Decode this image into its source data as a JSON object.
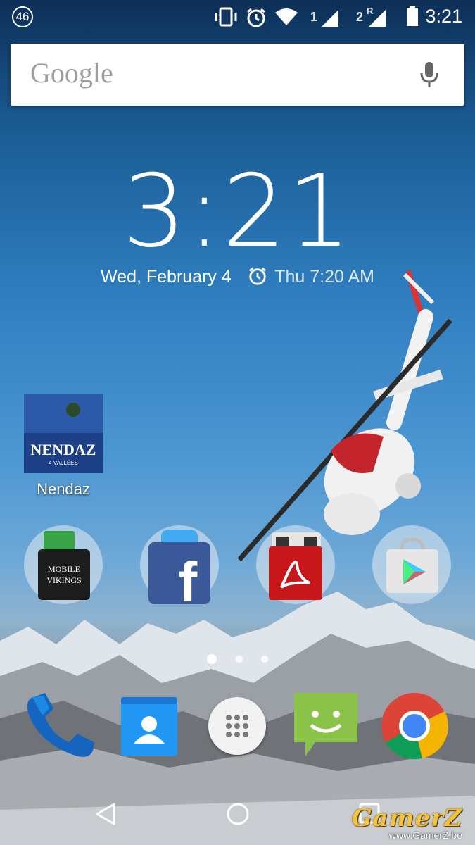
{
  "status_bar": {
    "notification_count": "46",
    "sim1_label": "1",
    "sim2_label": "2",
    "sim2_roaming": "R",
    "time": "3:21",
    "icons": [
      "vibrate-icon",
      "alarm-icon",
      "wifi-icon",
      "signal-icon",
      "signal-roaming-icon",
      "battery-icon"
    ]
  },
  "search": {
    "logo_text": "Google",
    "icons": [
      "mic-icon"
    ]
  },
  "clock_widget": {
    "time": "3:21",
    "date": "Wed, February 4",
    "next_alarm": "Thu 7:20 AM"
  },
  "shortcuts": [
    {
      "label": "Nendaz",
      "logo_text": "NENDAZ",
      "logo_subtext": "4 VALLÉES"
    }
  ],
  "folders": [
    {
      "icon": "mobile-vikings-icon",
      "text_line1": "MOBILE",
      "text_line2": "VIKINGS"
    },
    {
      "icon": "facebook-icon",
      "text": "f"
    },
    {
      "icon": "adobe-reader-icon"
    },
    {
      "icon": "play-store-icon"
    }
  ],
  "page_indicator": {
    "pages": 3,
    "active": 0
  },
  "dock": [
    {
      "icon": "phone-icon"
    },
    {
      "icon": "contacts-icon"
    },
    {
      "icon": "app-drawer-icon"
    },
    {
      "icon": "messaging-icon"
    },
    {
      "icon": "chrome-icon"
    }
  ],
  "nav": {
    "icons": [
      "back-icon",
      "home-icon",
      "recents-icon"
    ]
  },
  "watermark": {
    "logo": "GamerZ",
    "url": "www.GamerZ.be"
  },
  "colors": {
    "accent_blue": "#2a7bc4",
    "chrome_red": "#db4437",
    "messaging_green": "#8bc34a"
  }
}
